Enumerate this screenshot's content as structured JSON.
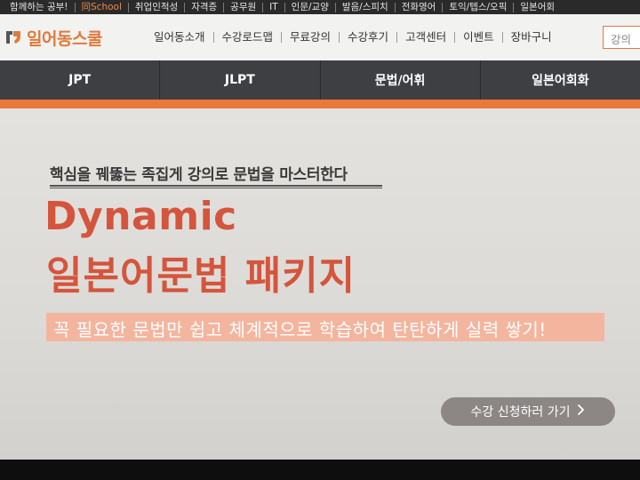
{
  "topbar": {
    "items": [
      "함께하는 공부!",
      "同School",
      "취업인적성",
      "자격증",
      "공무원",
      "IT",
      "인문/교양",
      "발음/스피치",
      "전화영어",
      "토익/텝스/오픽",
      "일본어회"
    ]
  },
  "header": {
    "logo_text": "일어동스쿨",
    "nav": [
      "일어동소개",
      "수강로드맵",
      "무료강의",
      "수강후기",
      "고객센터",
      "이벤트",
      "장바구니"
    ],
    "search_placeholder": "강의"
  },
  "category_nav": {
    "items": [
      "JPT",
      "JLPT",
      "문법/어휘",
      "일본어회화"
    ]
  },
  "banner": {
    "tagline": "핵심을 꿰뚫는 족집게 강의로 문법을 마스터한다",
    "title_en": "Dynamic",
    "title_ko": "일본어문법 패키지",
    "subtitle": "꼭 필요한 문법만 쉽고 체계적으로 학습하여 탄탄하게 실력 쌓기!",
    "cta_label": "수강 신청하러 가기",
    "cta_icon": "chevron-right-icon"
  },
  "colors": {
    "accent": "#e8793a",
    "title": "#d4553c",
    "highlight": "#f3b59e",
    "nav_bg": "#3d3f42"
  }
}
